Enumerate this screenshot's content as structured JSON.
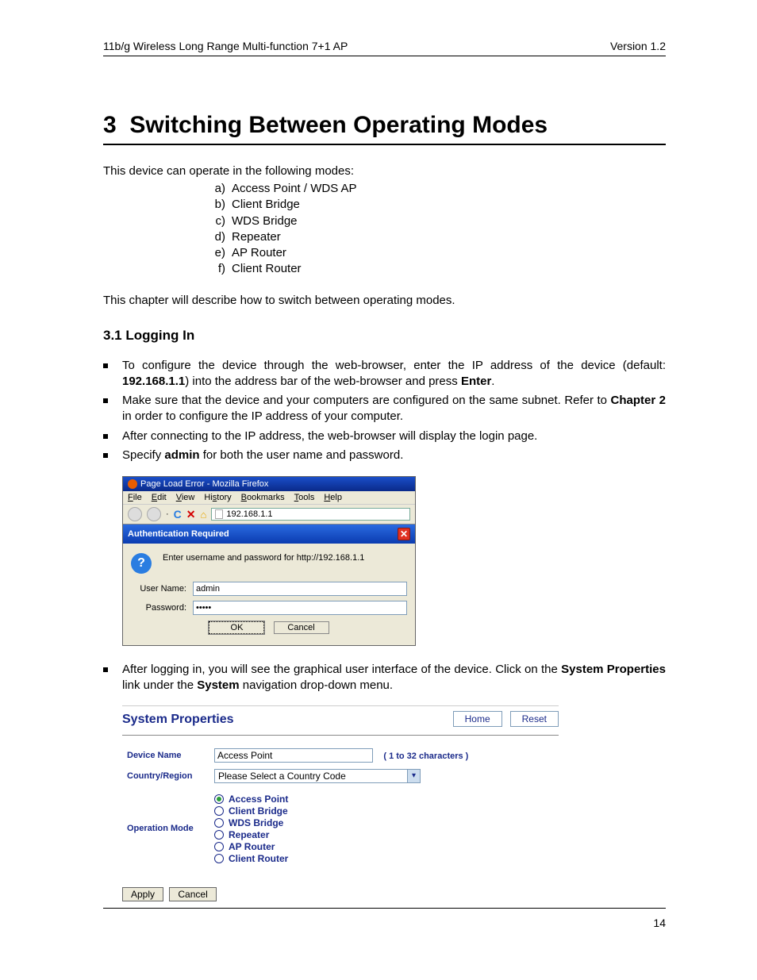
{
  "header": {
    "left": "11b/g Wireless Long Range Multi-function 7+1 AP",
    "right": "Version 1.2"
  },
  "chapter": {
    "num": "3",
    "title": "Switching Between Operating Modes"
  },
  "intro": "This device can operate in the following modes:",
  "modes": [
    {
      "letter": "a)",
      "label": "Access Point / WDS AP"
    },
    {
      "letter": "b)",
      "label": "Client Bridge"
    },
    {
      "letter": "c)",
      "label": "WDS Bridge"
    },
    {
      "letter": "d)",
      "label": "Repeater"
    },
    {
      "letter": "e)",
      "label": "AP Router"
    },
    {
      "letter": "f)",
      "label": "Client Router"
    }
  ],
  "chapter_desc": "This chapter will describe how to switch between operating modes.",
  "section": {
    "num": "3.1",
    "title": "Logging In"
  },
  "bullets1": [
    {
      "pre": "To configure the device through the web-browser, enter the IP address of the device (default: ",
      "b1": "192.168.1.1",
      "mid": ") into the address bar of the web-browser and press ",
      "b2": "Enter",
      "post": "."
    },
    {
      "pre": "Make sure that the device and your computers are configured on the same subnet. Refer to ",
      "b1": "Chapter 2",
      "mid": " in order to configure the IP address of your computer.",
      "b2": "",
      "post": ""
    },
    {
      "pre": "After connecting to the IP address, the web-browser will display the login page.",
      "b1": "",
      "mid": "",
      "b2": "",
      "post": ""
    },
    {
      "pre": "Specify ",
      "b1": "admin",
      "mid": " for both the user name and password.",
      "b2": "",
      "post": ""
    }
  ],
  "firefox": {
    "title": "Page Load Error - Mozilla Firefox",
    "menu": {
      "file": "File",
      "edit": "Edit",
      "view": "View",
      "history": "History",
      "bookmarks": "Bookmarks",
      "tools": "Tools",
      "help": "Help"
    },
    "toolbar": {
      "reload": "↻",
      "stop": "✕",
      "home": "⌂",
      "url": "192.168.1.1"
    },
    "auth": {
      "bar": "Authentication Required",
      "close": "✕",
      "msg": "Enter username and password for http://192.168.1.1",
      "user_lbl": "User Name:",
      "user_val": "admin",
      "pass_lbl": "Password:",
      "pass_val": "•••••",
      "ok": "OK",
      "cancel": "Cancel"
    }
  },
  "bullets2": [
    {
      "pre": "After logging in, you will see the graphical user interface of the device. Click on the ",
      "b1": "System Properties",
      "mid": " link under the ",
      "b2": "System",
      "post": " navigation drop-down menu."
    }
  ],
  "sys": {
    "title": "System Properties",
    "home": "Home",
    "reset": "Reset",
    "device_name_lbl": "Device Name",
    "device_name_val": "Access Point",
    "char_note": "( 1 to 32 characters )",
    "country_lbl": "Country/Region",
    "country_val": "Please Select a Country Code",
    "op_lbl": "Operation Mode",
    "ops": [
      {
        "label": "Access Point",
        "selected": true
      },
      {
        "label": "Client Bridge",
        "selected": false
      },
      {
        "label": "WDS Bridge",
        "selected": false
      },
      {
        "label": "Repeater",
        "selected": false
      },
      {
        "label": "AP Router",
        "selected": false
      },
      {
        "label": "Client Router",
        "selected": false
      }
    ],
    "apply": "Apply",
    "cancel": "Cancel"
  },
  "page_num": "14"
}
